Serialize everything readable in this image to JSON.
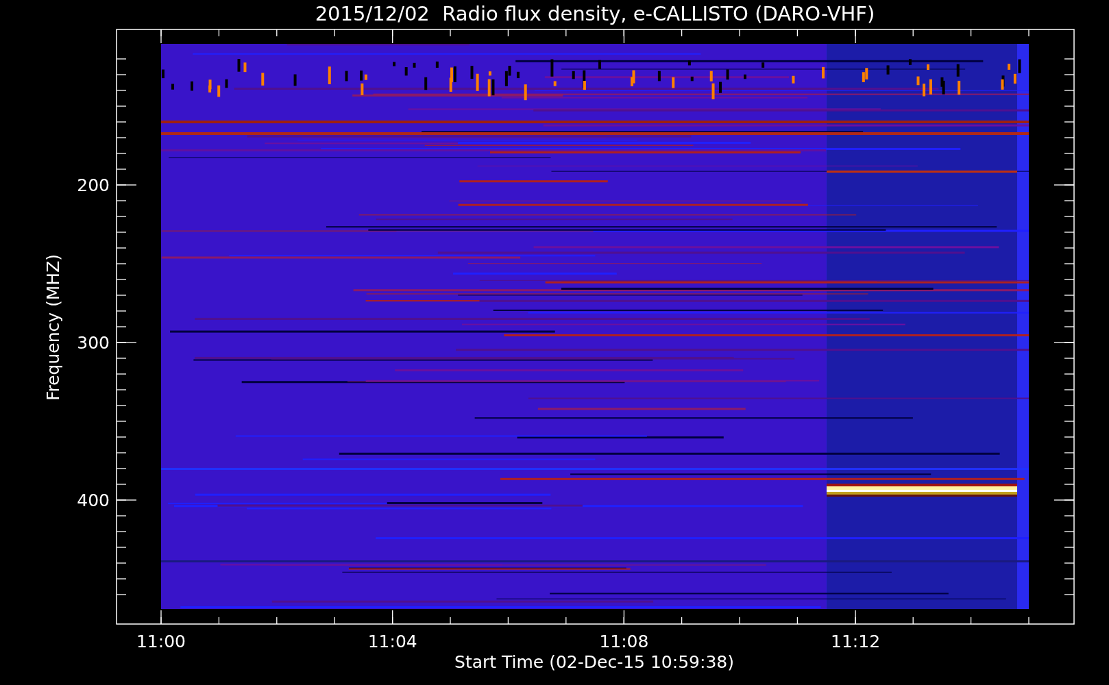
{
  "title": "2015/12/02  Radio flux density, e-CALLISTO (DARO-VHF)",
  "y_axis": {
    "label": "Frequency (MHZ)",
    "ticks": [
      "200",
      "300",
      "400"
    ]
  },
  "x_axis": {
    "label": "Start Time (02-Dec-15 10:59:38)",
    "ticks": [
      "11:00",
      "11:04",
      "11:08",
      "11:12"
    ]
  }
}
